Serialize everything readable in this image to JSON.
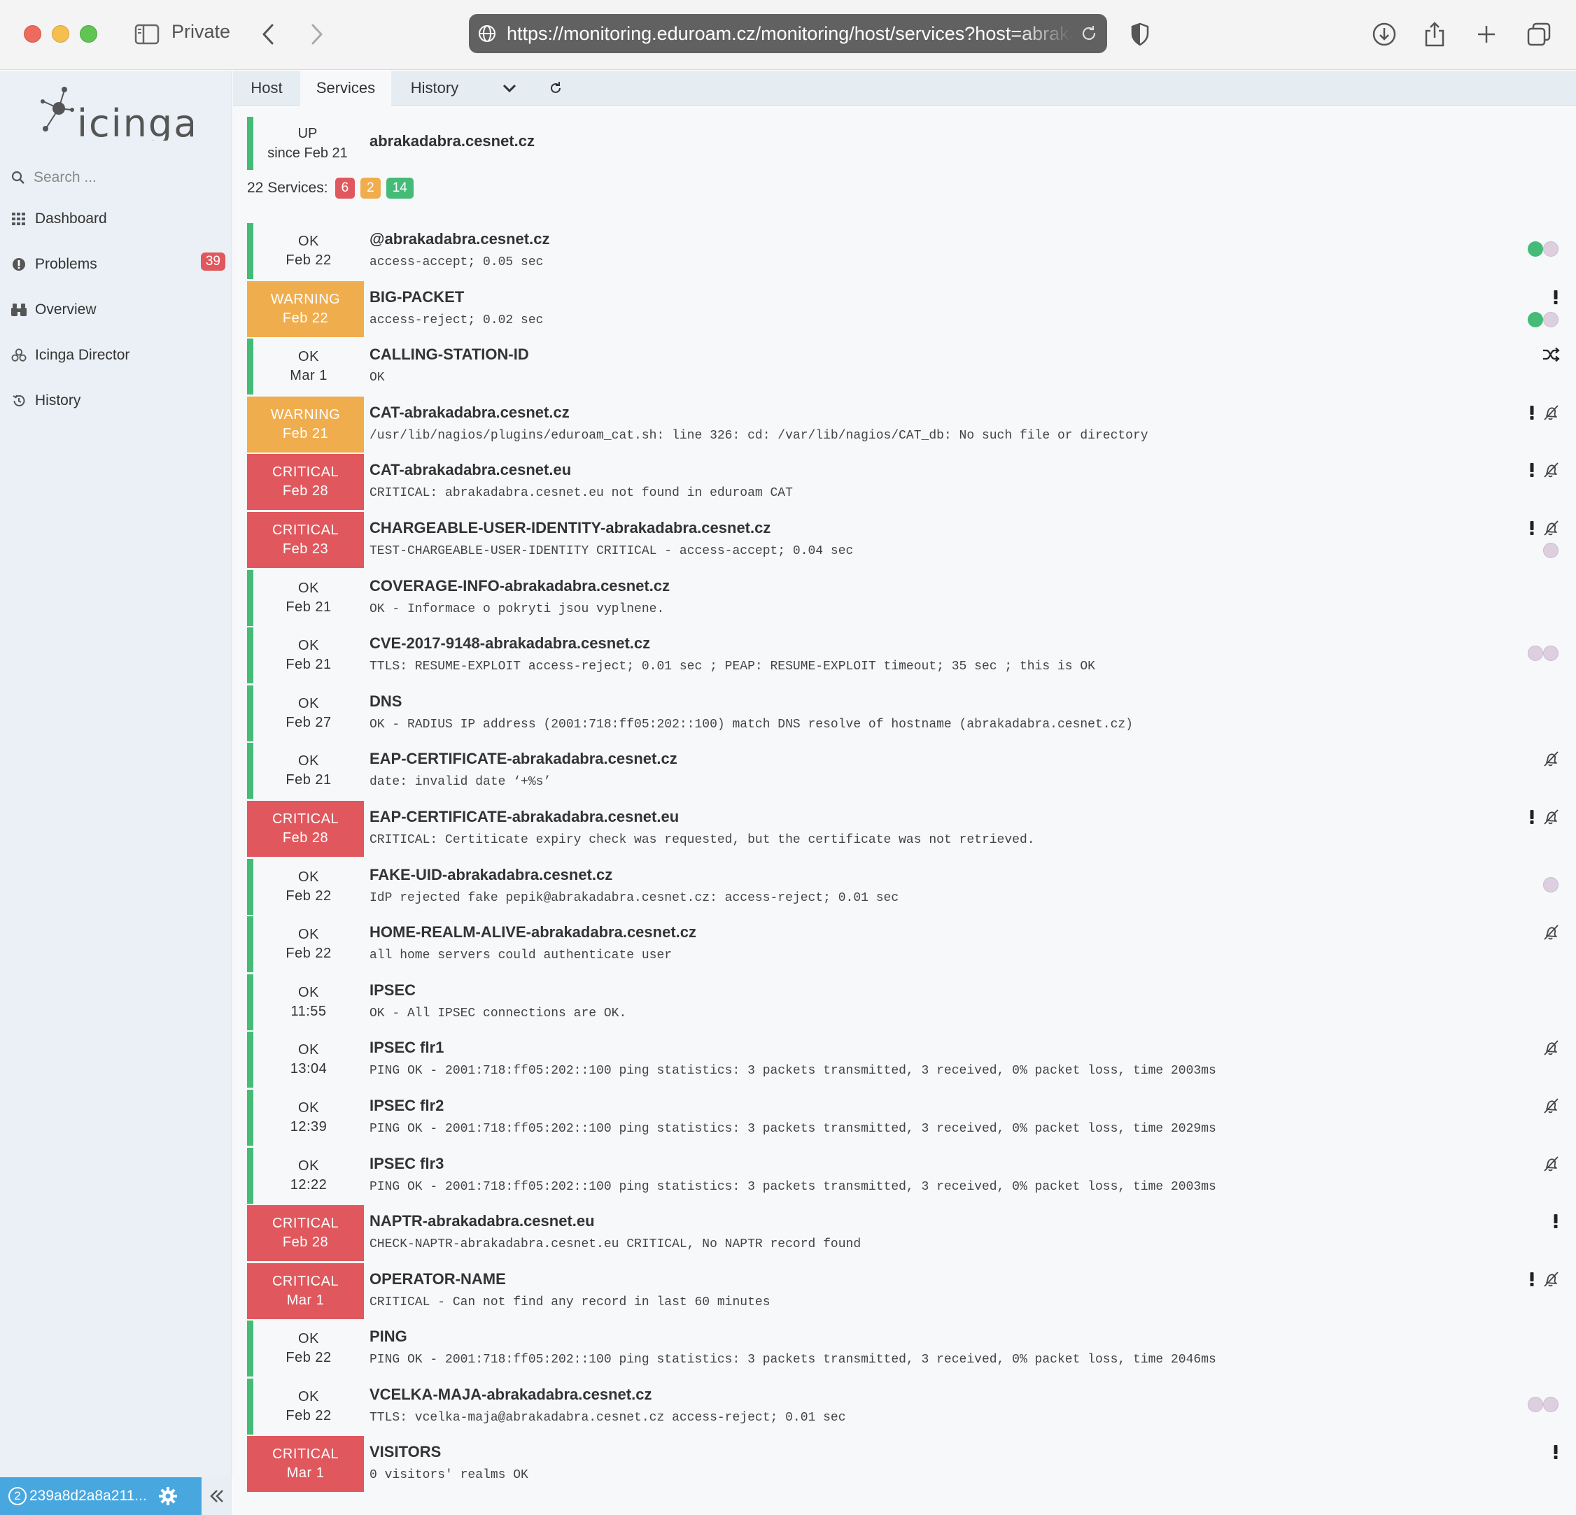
{
  "browser": {
    "private_label": "Private",
    "url": "https://monitoring.eduroam.cz/monitoring/host/services?host=abrakadabra.cesnet.cz"
  },
  "sidebar": {
    "logo_text": "icinga",
    "search_placeholder": "Search ...",
    "items": [
      {
        "label": "Dashboard",
        "icon": "dashboard-icon"
      },
      {
        "label": "Problems",
        "icon": "problems-icon",
        "badge": "39"
      },
      {
        "label": "Overview",
        "icon": "binoculars-icon"
      },
      {
        "label": "Icinga Director",
        "icon": "director-icon"
      },
      {
        "label": "History",
        "icon": "history-icon"
      }
    ],
    "footer": {
      "user_count": "2",
      "user_name": "239a8d2a8a211..."
    }
  },
  "tabs": [
    {
      "label": "Host"
    },
    {
      "label": "Services"
    },
    {
      "label": "History"
    }
  ],
  "host": {
    "state": "UP",
    "since": "since Feb 21",
    "name": "abrakadabra.cesnet.cz"
  },
  "summary": {
    "label": "22 Services:",
    "critical": "6",
    "warning": "2",
    "ok": "14"
  },
  "colors": {
    "ok": "#44bb77",
    "warning": "#f0ad4e",
    "critical": "#e0585d",
    "accent": "#49a7df"
  },
  "services": [
    {
      "state": "OK",
      "date": "Feb 22",
      "name": "@abrakadabra.cesnet.cz",
      "output": "access-accept; 0.05 sec",
      "icons": [
        "green-dot",
        "grey-dot"
      ]
    },
    {
      "state": "WARNING",
      "date": "Feb 22",
      "name": "BIG-PACKET",
      "output": "access-reject; 0.02 sec",
      "icons": [
        "exclamation",
        "green-dot",
        "grey-dot"
      ]
    },
    {
      "state": "OK",
      "date": "Mar 1",
      "name": "CALLING-STATION-ID",
      "output": "OK",
      "icons": [
        "shuffle"
      ]
    },
    {
      "state": "WARNING",
      "date": "Feb 21",
      "name": "CAT-abrakadabra.cesnet.cz",
      "output": "/usr/lib/nagios/plugins/eduroam_cat.sh: line 326: cd: /var/lib/nagios/CAT_db: No such file or directory",
      "icons": [
        "exclamation",
        "bell-off"
      ]
    },
    {
      "state": "CRITICAL",
      "date": "Feb 28",
      "name": "CAT-abrakadabra.cesnet.eu",
      "output": "CRITICAL: abrakadabra.cesnet.eu not found in eduroam CAT",
      "icons": [
        "exclamation",
        "bell-off"
      ]
    },
    {
      "state": "CRITICAL",
      "date": "Feb 23",
      "name": "CHARGEABLE-USER-IDENTITY-abrakadabra.cesnet.cz",
      "output": "TEST-CHARGEABLE-USER-IDENTITY CRITICAL - access-accept; 0.04 sec",
      "icons": [
        "exclamation",
        "bell-off",
        "grey-dot"
      ]
    },
    {
      "state": "OK",
      "date": "Feb 21",
      "name": "COVERAGE-INFO-abrakadabra.cesnet.cz",
      "output": "OK - Informace o pokryti jsou vyplnene.",
      "icons": []
    },
    {
      "state": "OK",
      "date": "Feb 21",
      "name": "CVE-2017-9148-abrakadabra.cesnet.cz",
      "output": "TTLS: RESUME-EXPLOIT access-reject; 0.01 sec ; PEAP: RESUME-EXPLOIT timeout; 35 sec ; this is OK",
      "icons": [
        "grey-dot",
        "grey-dot"
      ]
    },
    {
      "state": "OK",
      "date": "Feb 27",
      "name": "DNS",
      "output": "OK - RADIUS IP address (2001:718:ff05:202::100) match DNS resolve of hostname (abrakadabra.cesnet.cz)",
      "icons": []
    },
    {
      "state": "OK",
      "date": "Feb 21",
      "name": "EAP-CERTIFICATE-abrakadabra.cesnet.cz",
      "output": "date: invalid date ‘+%s’",
      "icons": [
        "bell-off"
      ]
    },
    {
      "state": "CRITICAL",
      "date": "Feb 28",
      "name": "EAP-CERTIFICATE-abrakadabra.cesnet.eu",
      "output": "CRITICAL: Certiticate expiry check was requested, but the certificate was not retrieved.",
      "icons": [
        "exclamation",
        "bell-off"
      ]
    },
    {
      "state": "OK",
      "date": "Feb 22",
      "name": "FAKE-UID-abrakadabra.cesnet.cz",
      "output": "IdP rejected fake pepik@abrakadabra.cesnet.cz: access-reject; 0.01 sec",
      "icons": [
        "grey-dot"
      ]
    },
    {
      "state": "OK",
      "date": "Feb 22",
      "name": "HOME-REALM-ALIVE-abrakadabra.cesnet.cz",
      "output": "all home servers could authenticate user",
      "icons": [
        "bell-off"
      ]
    },
    {
      "state": "OK",
      "date": "11:55",
      "name": "IPSEC",
      "output": "OK - All IPSEC connections are OK.",
      "icons": []
    },
    {
      "state": "OK",
      "date": "13:04",
      "name": "IPSEC flr1",
      "output": "PING OK - 2001:718:ff05:202::100 ping statistics: 3 packets transmitted, 3 received, 0% packet loss, time 2003ms",
      "icons": [
        "bell-off"
      ]
    },
    {
      "state": "OK",
      "date": "12:39",
      "name": "IPSEC flr2",
      "output": "PING OK - 2001:718:ff05:202::100 ping statistics: 3 packets transmitted, 3 received, 0% packet loss, time 2029ms",
      "icons": [
        "bell-off"
      ]
    },
    {
      "state": "OK",
      "date": "12:22",
      "name": "IPSEC flr3",
      "output": "PING OK - 2001:718:ff05:202::100 ping statistics: 3 packets transmitted, 3 received, 0% packet loss, time 2003ms",
      "icons": [
        "bell-off"
      ]
    },
    {
      "state": "CRITICAL",
      "date": "Feb 28",
      "name": "NAPTR-abrakadabra.cesnet.eu",
      "output": "CHECK-NAPTR-abrakadabra.cesnet.eu CRITICAL, No NAPTR record found",
      "icons": [
        "exclamation"
      ]
    },
    {
      "state": "CRITICAL",
      "date": "Mar 1",
      "name": "OPERATOR-NAME",
      "output": "CRITICAL - Can not find any record in last 60 minutes",
      "icons": [
        "exclamation",
        "bell-off"
      ]
    },
    {
      "state": "OK",
      "date": "Feb 22",
      "name": "PING",
      "output": "PING OK - 2001:718:ff05:202::100 ping statistics: 3 packets transmitted, 3 received, 0% packet loss, time 2046ms",
      "icons": []
    },
    {
      "state": "OK",
      "date": "Feb 22",
      "name": "VCELKA-MAJA-abrakadabra.cesnet.cz",
      "output": "TTLS: vcelka-maja@abrakadabra.cesnet.cz access-reject; 0.01 sec",
      "icons": [
        "grey-dot",
        "grey-dot"
      ]
    },
    {
      "state": "CRITICAL",
      "date": "Mar 1",
      "name": "VISITORS",
      "output": "0 visitors' realms OK",
      "icons": [
        "exclamation"
      ]
    }
  ]
}
